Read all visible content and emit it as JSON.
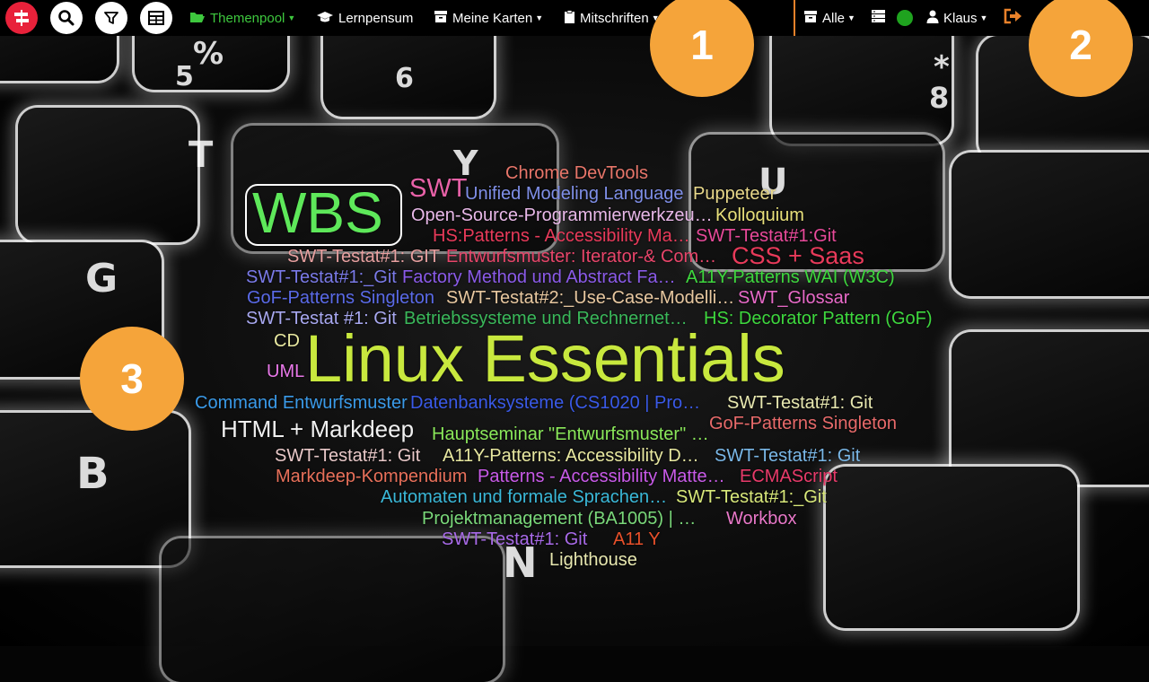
{
  "toolbar": {
    "themenpool": "Themenpool",
    "lernpensum": "Lernpensum",
    "meine_karten": "Meine Karten",
    "mitschriften": "Mitschriften",
    "alle": "Alle",
    "user": "Klaus",
    "status_color": "#1fa31f",
    "accent_color": "#e8812a"
  },
  "callouts": [
    "1",
    "2",
    "3"
  ],
  "keyboard_labels": [
    "%",
    "5",
    "6",
    "*",
    "8",
    "T",
    "Y",
    "U",
    "G",
    "B",
    "N"
  ],
  "cloud": [
    {
      "text": "Chrome DevTools",
      "color": "#e8766a"
    },
    {
      "text": "SWT",
      "color": "#e862a8"
    },
    {
      "text": "Unified Modeling Language",
      "color": "#7f8fe8"
    },
    {
      "text": "Puppeteer",
      "color": "#e8d88a"
    },
    {
      "text": "WBS",
      "color": "#5ee85a"
    },
    {
      "text": "Open-Source-Programmierwerkzeu…",
      "color": "#e8b8e8"
    },
    {
      "text": "Kolloquium",
      "color": "#e8e07a"
    },
    {
      "text": "HS:Patterns - Accessibility Ma…",
      "color": "#e83a5a"
    },
    {
      "text": "SWT-Testat#1:Git",
      "color": "#e84a9a"
    },
    {
      "text": "SWT-Testat#1: GIT",
      "color": "#e8a0a0"
    },
    {
      "text": "Entwurfsmuster: Iterator-& Com…",
      "color": "#e8456a"
    },
    {
      "text": "CSS + Saas",
      "color": "#e83a5a"
    },
    {
      "text": "SWT-Testat#1:_Git",
      "color": "#7a7ae8"
    },
    {
      "text": "Factory Method und Abstract Fa…",
      "color": "#8a5ae8"
    },
    {
      "text": "A11Y-Patterns WAI (W3C)",
      "color": "#3ed83e"
    },
    {
      "text": "GoF-Patterns Singleton",
      "color": "#5a6ae8"
    },
    {
      "text": "SWT-Testat#2:_Use-Case-Modelli…",
      "color": "#e8c8a0"
    },
    {
      "text": "SWT_Glossar",
      "color": "#e86ac8"
    },
    {
      "text": "SWT-Testat #1: Git",
      "color": "#a8a8f0"
    },
    {
      "text": "Betriebssysteme und Rechnernet…",
      "color": "#3ab85a"
    },
    {
      "text": "HS: Decorator Pattern (GoF)",
      "color": "#3ed83e"
    },
    {
      "text": "CD",
      "color": "#e8e8a0"
    },
    {
      "text": "Linux Essentials",
      "color": "#c8e83e"
    },
    {
      "text": "UML",
      "color": "#e878e8"
    },
    {
      "text": "Command Entwurfsmuster",
      "color": "#3a9ae8"
    },
    {
      "text": "Datenbanksysteme (CS1020 | Pro…",
      "color": "#3a5ae8"
    },
    {
      "text": "SWT-Testat#1:  Git",
      "color": "#e8e8b0"
    },
    {
      "text": "HTML + Markdeep",
      "color": "#f0f0f0"
    },
    {
      "text": "GoF-Patterns Singleton",
      "color": "#e86a6a"
    },
    {
      "text": "Hauptseminar \"Entwurfsmuster\" …",
      "color": "#8ae85a"
    },
    {
      "text": "SWT-Testat#1: Git",
      "color": "#e8c8c8"
    },
    {
      "text": "A11Y-Patterns: Accessibility D…",
      "color": "#e8e8a0"
    },
    {
      "text": "SWT-Testat#1: Git",
      "color": "#7ab8e8"
    },
    {
      "text": "Markdeep-Kompendium",
      "color": "#e8705a"
    },
    {
      "text": "Patterns - Accessibility Matte…",
      "color": "#c85ae8"
    },
    {
      "text": "ECMAScript",
      "color": "#e83a6a"
    },
    {
      "text": "Automaten und formale Sprachen…",
      "color": "#3ab8d8"
    },
    {
      "text": "SWT-Testat#1:_Git",
      "color": "#d8e87a"
    },
    {
      "text": "Projektmanagement (BA1005)  | …",
      "color": "#7ad87a"
    },
    {
      "text": "Workbox",
      "color": "#e878c8"
    },
    {
      "text": "SWT-Testat#1: Git",
      "color": "#a86ae8"
    },
    {
      "text": "A11 Y",
      "color": "#e8502a"
    },
    {
      "text": "Lighthouse",
      "color": "#e8e8b0"
    }
  ]
}
